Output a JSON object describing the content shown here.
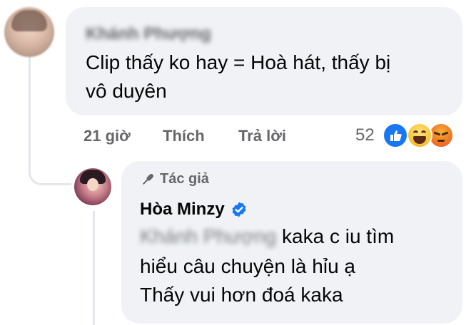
{
  "comment": {
    "author_name": "Khánh Phượng",
    "text_line1": "Clip thấy ko hay = Hoà hát, thấy bị",
    "text_line2": "vô duyên",
    "time": "21 giờ",
    "like_label": "Thích",
    "reply_label": "Trả lời",
    "reaction_count": "52",
    "reactions": [
      "like-icon",
      "haha-icon",
      "angry-icon"
    ],
    "colors": {
      "bubble": "#f0f2f5",
      "meta": "#65676b",
      "like": "#1877f2",
      "verified": "#1877f2"
    }
  },
  "reply": {
    "badge_label": "Tác giả",
    "author_name": "Hòa Minzy",
    "mention": "Khánh Phượng",
    "text_line1_tail": "kaka c iu tìm",
    "text_line2": "hiểu câu chuyện là hỉu ạ",
    "text_line3": "Thấy vui hơn đoá kaka"
  }
}
